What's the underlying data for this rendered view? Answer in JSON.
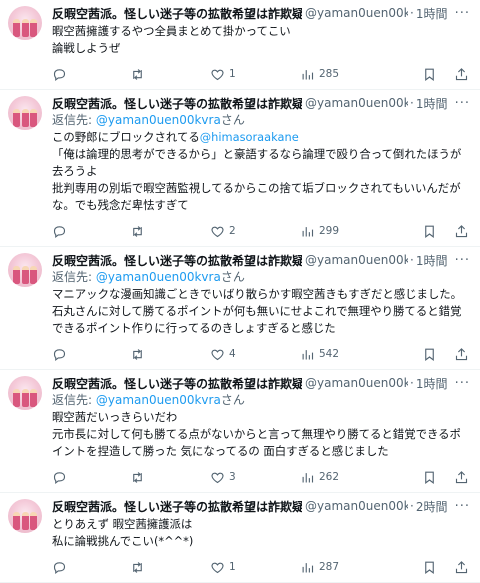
{
  "tweets": [
    {
      "name": "反暇空茜派。怪しい迷子等の拡散希望は詐欺疑惑濃厚",
      "handle": "@yaman0uen00kvra",
      "time": "1時間",
      "reply_prefix": "",
      "reply_mention": "",
      "reply_suffix": "",
      "text_mention": "",
      "text": "暇空茜擁護するやつ全員まとめて掛かってこい\n論戦しようぜ",
      "replies": "",
      "retweets": "",
      "likes": "1",
      "views": "285"
    },
    {
      "name": "反暇空茜派。怪しい迷子等の拡散希望は詐欺疑惑濃厚",
      "handle": "@yaman0uen00kvra",
      "time": "1時間",
      "reply_prefix": "返信先: ",
      "reply_mention": "@yaman0uen00kvra",
      "reply_suffix": "さん",
      "text_before": "この野郎にブロックされてる",
      "text_mention": "@himasoraakane",
      "text": "\n「俺は論理的思考ができるから」と豪語するなら論理で殴り合って倒れたほうが去ろうよ\n批判専用の別垢で暇空茜監視してるからこの捨て垢ブロックされてもいいんだがな。でも残念だ卑怯すぎて",
      "replies": "",
      "retweets": "",
      "likes": "2",
      "views": "299"
    },
    {
      "name": "反暇空茜派。怪しい迷子等の拡散希望は詐欺疑惑濃厚",
      "handle": "@yaman0uen00kvra",
      "time": "1時間",
      "reply_prefix": "返信先: ",
      "reply_mention": "@yaman0uen00kvra",
      "reply_suffix": "さん",
      "text_mention": "",
      "text": "マニアックな漫画知識ごときでいばり散らかす暇空茜きもすぎだと感じました。石丸さんに対して勝てるポイントが何も無いにせよこれで無理やり勝てると錯覚できるポイント作りに行ってるのきしょすぎると感じた",
      "replies": "",
      "retweets": "",
      "likes": "4",
      "views": "542"
    },
    {
      "name": "反暇空茜派。怪しい迷子等の拡散希望は詐欺疑惑濃厚",
      "handle": "@yaman0uen00kvra",
      "time": "1時間",
      "reply_prefix": "返信先: ",
      "reply_mention": "@yaman0uen00kvra",
      "reply_suffix": "さん",
      "text_mention": "",
      "text": "暇空茜だいっきらいだわ\n元市長に対して何も勝てる点がないからと言って無理やり勝てると錯覚できるポイントを捏造して勝った 気になってるの 面白すぎると感じました",
      "replies": "",
      "retweets": "",
      "likes": "3",
      "views": "262"
    },
    {
      "name": "反暇空茜派。怪しい迷子等の拡散希望は詐欺疑惑濃厚",
      "handle": "@yaman0uen00kvra",
      "time": "2時間",
      "reply_prefix": "",
      "reply_mention": "",
      "reply_suffix": "",
      "text_mention": "",
      "text": "とりあえず 暇空茜擁護派は\n私に論戦挑んでこい(*^^*)",
      "replies": "",
      "retweets": "",
      "likes": "1",
      "views": "287"
    }
  ],
  "labels": {
    "dot": "·",
    "more": "···"
  },
  "icons": [
    "reply-icon",
    "retweet-icon",
    "like-icon",
    "views-icon",
    "bookmark-icon",
    "share-icon"
  ],
  "colors": {
    "link": "#1d9bf0",
    "muted": "#536471",
    "text": "#0f1419",
    "divider": "#eff3f4"
  }
}
